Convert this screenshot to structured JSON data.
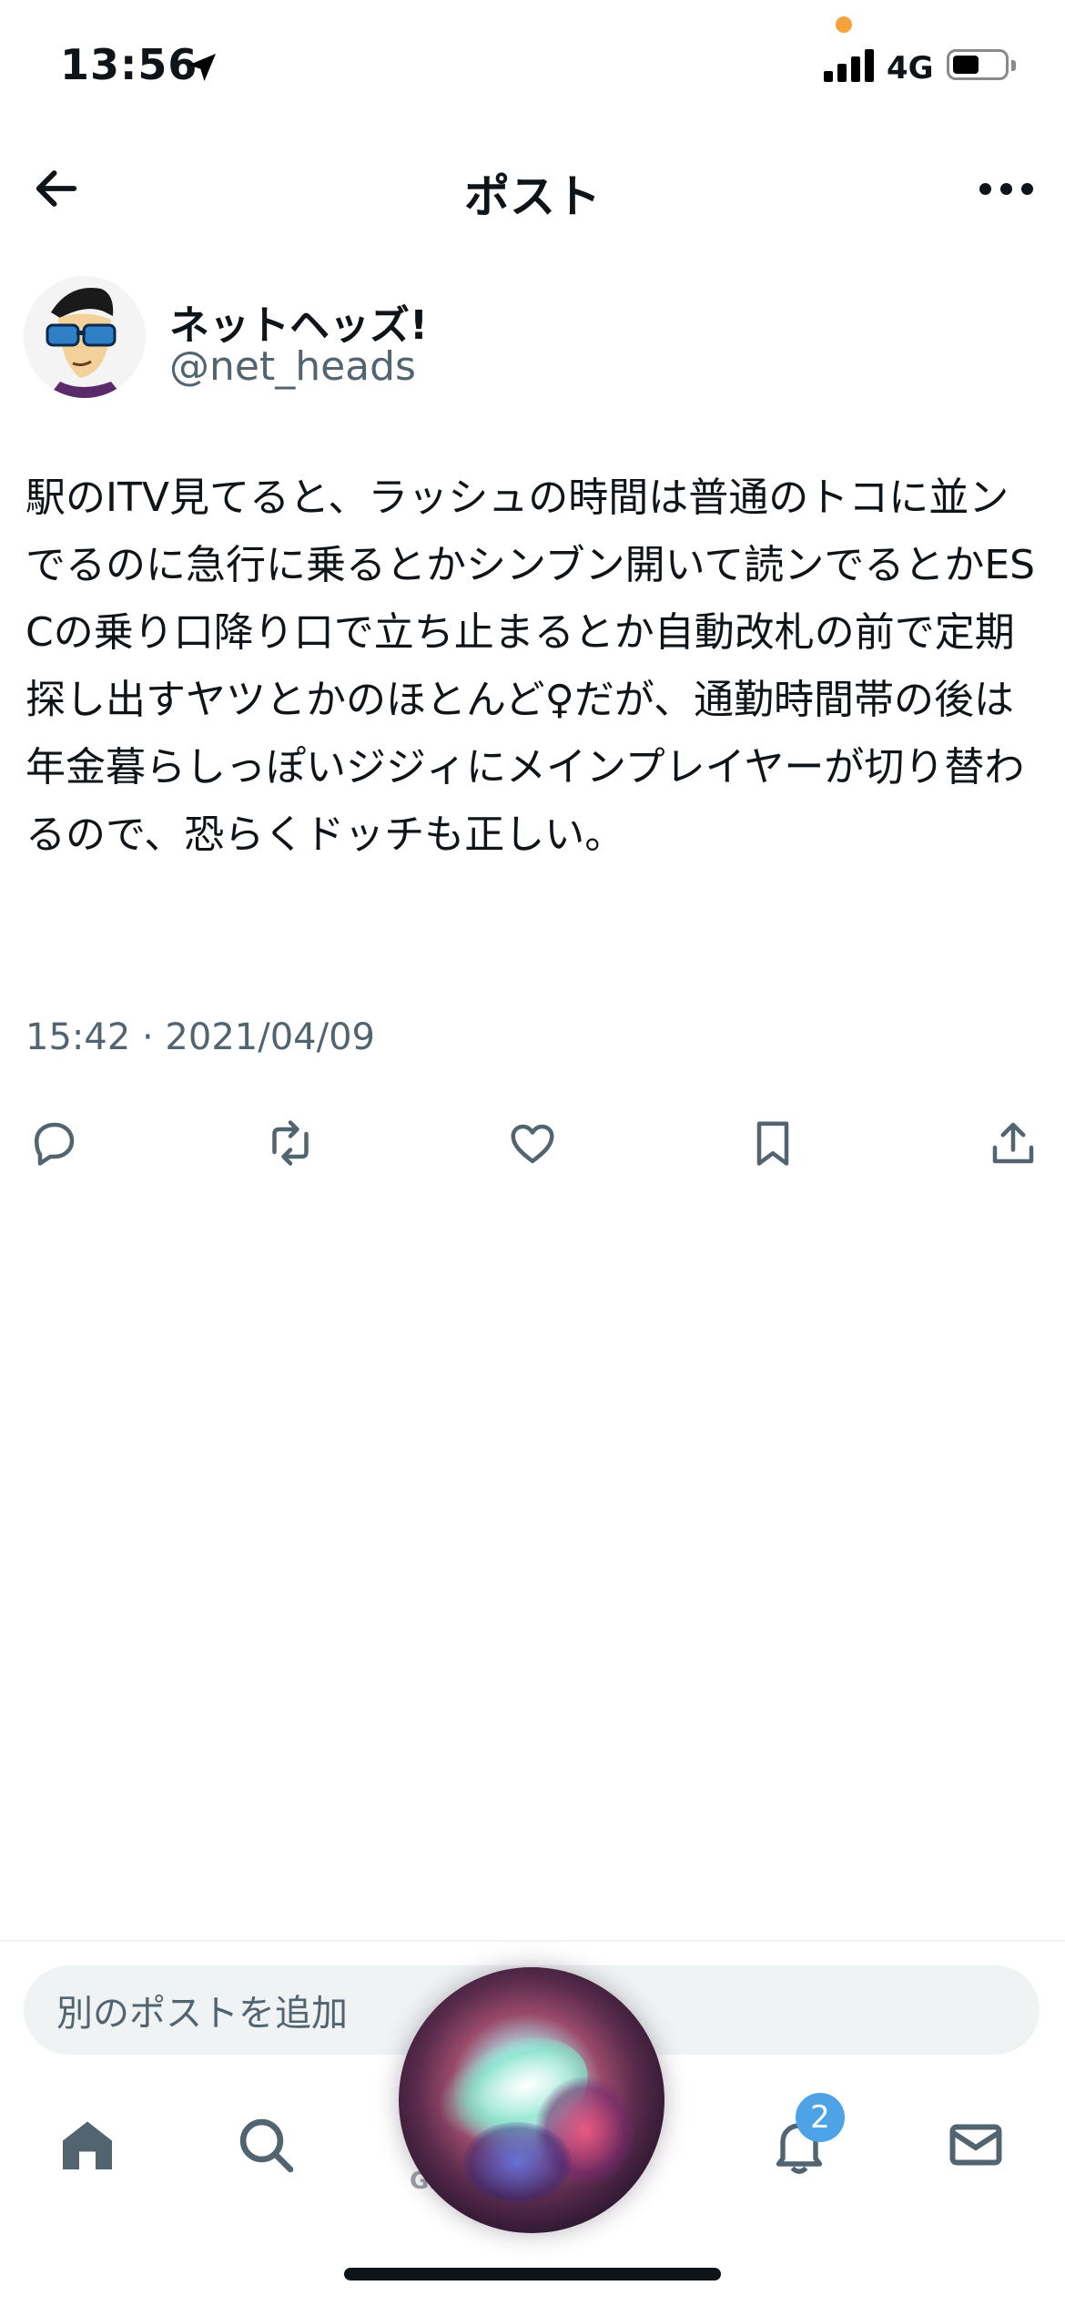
{
  "status_bar": {
    "time": "13:56",
    "network": "4G"
  },
  "header": {
    "title": "ポスト"
  },
  "author": {
    "display_name": "ネットヘッズ!",
    "handle": "@net_heads"
  },
  "post": {
    "text": "駅のITV見てると、ラッシュの時間は普通のトコに並ンでるのに急行に乗るとかシンブン開いて読ンでるとかESCの乗り口降り口で立ち止まるとか自動改札の前で定期探し出すヤツとかのほとんど♀だが、通勤時間帯の後は年金暮らしっぽいジジィにメインプレイヤーが切り替わるので、恐らくドッチも正しい。",
    "timestamp": "15:42 · 2021/04/09"
  },
  "compose": {
    "placeholder": "別のポストを追加"
  },
  "tabbar": {
    "grok_label": "Gr",
    "notifications_badge": "2"
  },
  "colors": {
    "text": "#0f1419",
    "secondary": "#536471",
    "badge": "#4da3e6",
    "input_bg": "#eff3f4"
  }
}
